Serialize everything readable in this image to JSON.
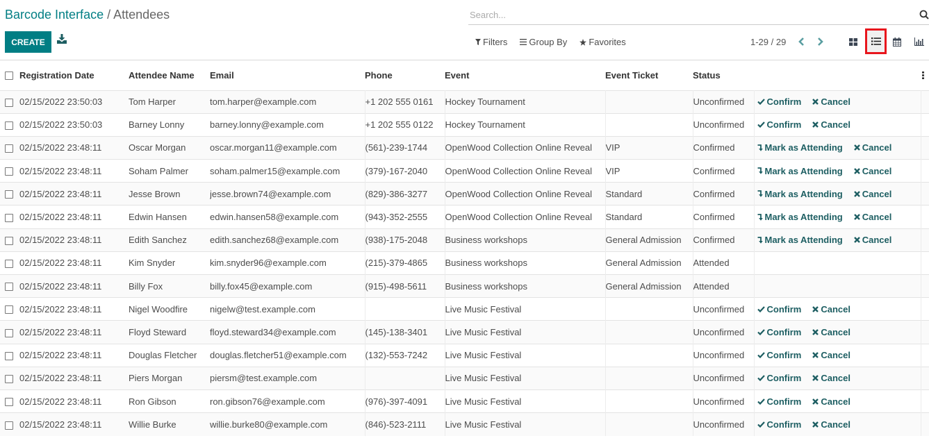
{
  "breadcrumb": {
    "parent": "Barcode Interface",
    "separator": " / ",
    "current": "Attendees"
  },
  "toolbar": {
    "create_label": "CREATE",
    "download_icon": "download-icon"
  },
  "search": {
    "placeholder": "Search...",
    "value": ""
  },
  "filters": {
    "filters_label": "Filters",
    "group_by_label": "Group By",
    "favorites_label": "Favorites"
  },
  "pager": {
    "text": "1-29 / 29"
  },
  "views": {
    "active": "list",
    "items": [
      "kanban",
      "list",
      "calendar",
      "graph"
    ]
  },
  "accent_color": "#017e84",
  "highlight_color": "#e8161d",
  "table": {
    "columns": [
      "Registration Date",
      "Attendee Name",
      "Email",
      "Phone",
      "Event",
      "Event Ticket",
      "Status"
    ],
    "rows": [
      {
        "date": "02/15/2022 23:50:03",
        "name": "Tom Harper",
        "email": "tom.harper@example.com",
        "phone": "+1 202 555 0161",
        "event": "Hockey Tournament",
        "ticket": "",
        "status": "Unconfirmed",
        "actions": [
          "Confirm",
          "Cancel"
        ]
      },
      {
        "date": "02/15/2022 23:50:03",
        "name": "Barney Lonny",
        "email": "barney.lonny@example.com",
        "phone": "+1 202 555 0122",
        "event": "Hockey Tournament",
        "ticket": "",
        "status": "Unconfirmed",
        "actions": [
          "Confirm",
          "Cancel"
        ]
      },
      {
        "date": "02/15/2022 23:48:11",
        "name": "Oscar Morgan",
        "email": "oscar.morgan11@example.com",
        "phone": "(561)-239-1744",
        "event": "OpenWood Collection Online Reveal",
        "ticket": "VIP",
        "status": "Confirmed",
        "actions": [
          "Mark as Attending",
          "Cancel"
        ]
      },
      {
        "date": "02/15/2022 23:48:11",
        "name": "Soham Palmer",
        "email": "soham.palmer15@example.com",
        "phone": "(379)-167-2040",
        "event": "OpenWood Collection Online Reveal",
        "ticket": "VIP",
        "status": "Confirmed",
        "actions": [
          "Mark as Attending",
          "Cancel"
        ]
      },
      {
        "date": "02/15/2022 23:48:11",
        "name": "Jesse Brown",
        "email": "jesse.brown74@example.com",
        "phone": "(829)-386-3277",
        "event": "OpenWood Collection Online Reveal",
        "ticket": "Standard",
        "status": "Confirmed",
        "actions": [
          "Mark as Attending",
          "Cancel"
        ]
      },
      {
        "date": "02/15/2022 23:48:11",
        "name": "Edwin Hansen",
        "email": "edwin.hansen58@example.com",
        "phone": "(943)-352-2555",
        "event": "OpenWood Collection Online Reveal",
        "ticket": "Standard",
        "status": "Confirmed",
        "actions": [
          "Mark as Attending",
          "Cancel"
        ]
      },
      {
        "date": "02/15/2022 23:48:11",
        "name": "Edith Sanchez",
        "email": "edith.sanchez68@example.com",
        "phone": "(938)-175-2048",
        "event": "Business workshops",
        "ticket": "General Admission",
        "status": "Confirmed",
        "actions": [
          "Mark as Attending",
          "Cancel"
        ]
      },
      {
        "date": "02/15/2022 23:48:11",
        "name": "Kim Snyder",
        "email": "kim.snyder96@example.com",
        "phone": "(215)-379-4865",
        "event": "Business workshops",
        "ticket": "General Admission",
        "status": "Attended",
        "actions": []
      },
      {
        "date": "02/15/2022 23:48:11",
        "name": "Billy Fox",
        "email": "billy.fox45@example.com",
        "phone": "(915)-498-5611",
        "event": "Business workshops",
        "ticket": "General Admission",
        "status": "Attended",
        "actions": []
      },
      {
        "date": "02/15/2022 23:48:11",
        "name": "Nigel Woodfire",
        "email": "nigelw@test.example.com",
        "phone": "",
        "event": "Live Music Festival",
        "ticket": "",
        "status": "Unconfirmed",
        "actions": [
          "Confirm",
          "Cancel"
        ]
      },
      {
        "date": "02/15/2022 23:48:11",
        "name": "Floyd Steward",
        "email": "floyd.steward34@example.com",
        "phone": "(145)-138-3401",
        "event": "Live Music Festival",
        "ticket": "",
        "status": "Unconfirmed",
        "actions": [
          "Confirm",
          "Cancel"
        ]
      },
      {
        "date": "02/15/2022 23:48:11",
        "name": "Douglas Fletcher",
        "email": "douglas.fletcher51@example.com",
        "phone": "(132)-553-7242",
        "event": "Live Music Festival",
        "ticket": "",
        "status": "Unconfirmed",
        "actions": [
          "Confirm",
          "Cancel"
        ]
      },
      {
        "date": "02/15/2022 23:48:11",
        "name": "Piers Morgan",
        "email": "piersm@test.example.com",
        "phone": "",
        "event": "Live Music Festival",
        "ticket": "",
        "status": "Unconfirmed",
        "actions": [
          "Confirm",
          "Cancel"
        ]
      },
      {
        "date": "02/15/2022 23:48:11",
        "name": "Ron Gibson",
        "email": "ron.gibson76@example.com",
        "phone": "(976)-397-4091",
        "event": "Live Music Festival",
        "ticket": "",
        "status": "Unconfirmed",
        "actions": [
          "Confirm",
          "Cancel"
        ]
      },
      {
        "date": "02/15/2022 23:48:11",
        "name": "Willie Burke",
        "email": "willie.burke80@example.com",
        "phone": "(846)-523-2111",
        "event": "Live Music Festival",
        "ticket": "",
        "status": "Unconfirmed",
        "actions": [
          "Confirm",
          "Cancel"
        ]
      }
    ]
  }
}
